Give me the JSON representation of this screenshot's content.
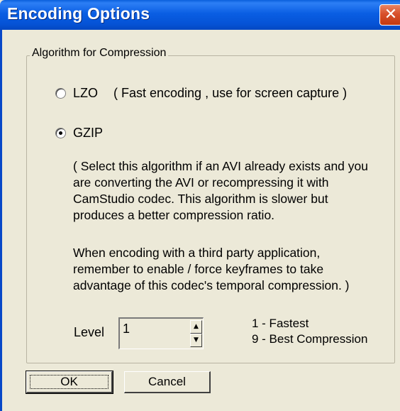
{
  "window": {
    "title": "Encoding Options",
    "close_symbol": "✕"
  },
  "group": {
    "label": "Algorithm for Compression"
  },
  "options": {
    "lzo": {
      "label": "LZO",
      "description": "( Fast encoding , use for screen capture )",
      "selected": false
    },
    "gzip": {
      "label": "GZIP",
      "selected": true,
      "description_lines": [
        "( Select this algorithm if an AVI already exists and you",
        "are converting the AVI or recompressing it with",
        "CamStudio codec. This algorithm is slower but",
        "produces a better compression ratio."
      ],
      "note_lines": [
        "When encoding with a third party application,",
        "remember to enable / force keyframes to take",
        "advantage of this codec's temporal compression. )"
      ]
    }
  },
  "level": {
    "label": "Level",
    "value": "1",
    "hint_fast": "1 - Fastest",
    "hint_best": "9 - Best Compression"
  },
  "buttons": {
    "ok": "OK",
    "cancel": "Cancel"
  }
}
